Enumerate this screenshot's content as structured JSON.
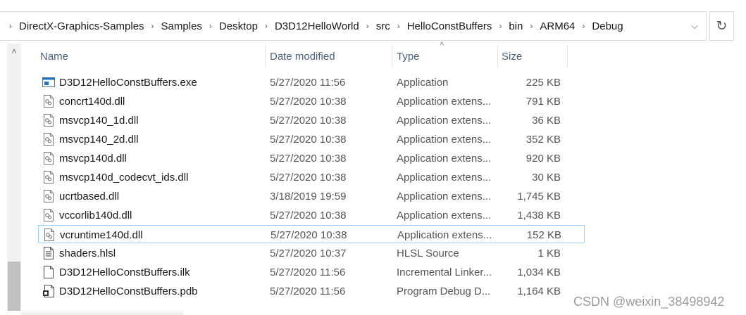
{
  "address": {
    "crumbs": [
      "DirectX-Graphics-Samples",
      "Samples",
      "Desktop",
      "D3D12HelloWorld",
      "src",
      "HelloConstBuffers",
      "bin",
      "ARM64",
      "Debug"
    ]
  },
  "columns": {
    "name": "Name",
    "date": "Date modified",
    "type": "Type",
    "size": "Size"
  },
  "files": [
    {
      "name": "D3D12HelloConstBuffers.exe",
      "date": "5/27/2020 11:56",
      "type": "Application",
      "size": "225 KB",
      "icon": "exe-icon"
    },
    {
      "name": "concrt140d.dll",
      "date": "5/27/2020 10:38",
      "type": "Application extens...",
      "size": "791 KB",
      "icon": "dll-icon"
    },
    {
      "name": "msvcp140_1d.dll",
      "date": "5/27/2020 10:38",
      "type": "Application extens...",
      "size": "36 KB",
      "icon": "dll-icon"
    },
    {
      "name": "msvcp140_2d.dll",
      "date": "5/27/2020 10:38",
      "type": "Application extens...",
      "size": "352 KB",
      "icon": "dll-icon"
    },
    {
      "name": "msvcp140d.dll",
      "date": "5/27/2020 10:38",
      "type": "Application extens...",
      "size": "920 KB",
      "icon": "dll-icon"
    },
    {
      "name": "msvcp140d_codecvt_ids.dll",
      "date": "5/27/2020 10:38",
      "type": "Application extens...",
      "size": "30 KB",
      "icon": "dll-icon"
    },
    {
      "name": "ucrtbased.dll",
      "date": "3/18/2019 19:59",
      "type": "Application extens...",
      "size": "1,745 KB",
      "icon": "dll-icon"
    },
    {
      "name": "vccorlib140d.dll",
      "date": "5/27/2020 10:38",
      "type": "Application extens...",
      "size": "1,438 KB",
      "icon": "dll-icon"
    },
    {
      "name": "vcruntime140d.dll",
      "date": "5/27/2020 10:38",
      "type": "Application extens...",
      "size": "152 KB",
      "icon": "dll-icon",
      "selected": true
    },
    {
      "name": "shaders.hlsl",
      "date": "5/27/2020 10:37",
      "type": "HLSL Source",
      "size": "1 KB",
      "icon": "text-file-icon"
    },
    {
      "name": "D3D12HelloConstBuffers.ilk",
      "date": "5/27/2020 11:56",
      "type": "Incremental Linker...",
      "size": "1,034 KB",
      "icon": "blank-file-icon"
    },
    {
      "name": "D3D12HelloConstBuffers.pdb",
      "date": "5/27/2020 11:56",
      "type": "Program Debug D...",
      "size": "1,164 KB",
      "icon": "pdb-icon"
    }
  ],
  "watermark": "CSDN @weixin_38498942",
  "colors": {
    "header_text": "#4c607a",
    "selection_border": "#99d1ff",
    "exe_blue": "#1e73be"
  }
}
